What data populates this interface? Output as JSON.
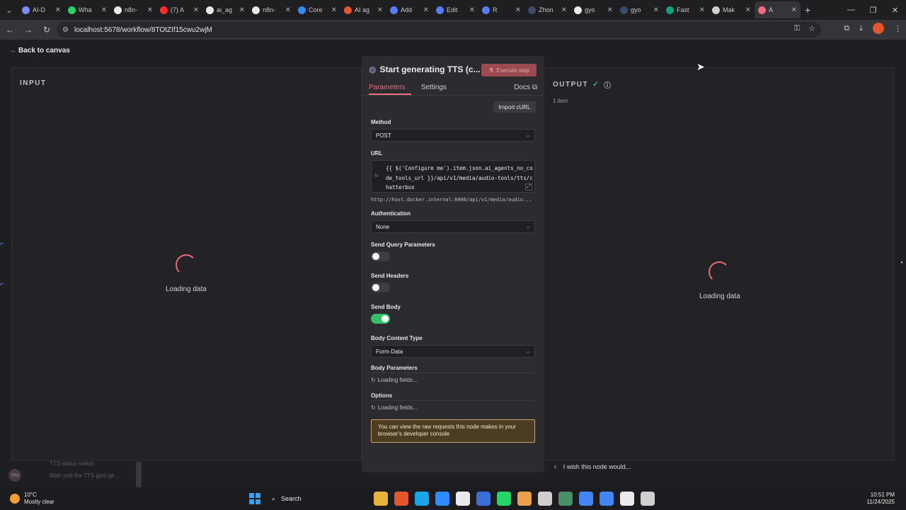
{
  "browser": {
    "tabs": [
      {
        "label": "AI-D",
        "color": "#7b8cff"
      },
      {
        "label": "Wha",
        "color": "#25d366"
      },
      {
        "label": "n8n-",
        "color": "#eaeaea"
      },
      {
        "label": "(7) A",
        "color": "#ff2d2d"
      },
      {
        "label": "ai_ag",
        "color": "#eaeaea"
      },
      {
        "label": "n8n-",
        "color": "#eaeaea"
      },
      {
        "label": "Core",
        "color": "#2d8cff"
      },
      {
        "label": "AI ag",
        "color": "#e4572e"
      },
      {
        "label": "Add",
        "color": "#5a7bff"
      },
      {
        "label": "Edit",
        "color": "#5a7bff"
      },
      {
        "label": "R",
        "color": "#5a7bff"
      },
      {
        "label": "Zhon",
        "color": "#444a66"
      },
      {
        "label": "gyo",
        "color": "#eaeaea"
      },
      {
        "label": "gyo",
        "color": "#3a4a6a"
      },
      {
        "label": "Fast",
        "color": "#10a37f"
      },
      {
        "label": "Mak",
        "color": "#cfcfcf"
      },
      {
        "label": "A",
        "color": "#ef6b7d"
      }
    ],
    "address": "localhost:5678/workflow/8TOtZIf15cwu2wjM"
  },
  "app": {
    "back_label": "Back to canvas",
    "input_title": "INPUT",
    "output_title": "OUTPUT",
    "item_count": "1 item",
    "loading_data": "Loading data",
    "wish": "I wish this node would..."
  },
  "node": {
    "title": "Start generating TTS (c...",
    "execute_label": "Execute step",
    "tabs": {
      "parameters": "Parameters",
      "settings": "Settings",
      "docs": "Docs"
    },
    "import_curl": "Import cURL",
    "method": {
      "label": "Method",
      "value": "POST"
    },
    "url": {
      "label": "URL",
      "expression": "{{ $('Configure me').item.json.ai_agents_no_code_tools_url }}/api/v1/media/audio-tools/tts/chatterbox",
      "resolved": "http://host.docker.internal:8000/api/v1/media/audio..."
    },
    "authentication": {
      "label": "Authentication",
      "value": "None"
    },
    "send_query": {
      "label": "Send Query Parameters",
      "on": false
    },
    "send_headers": {
      "label": "Send Headers",
      "on": false
    },
    "send_body": {
      "label": "Send Body",
      "on": true
    },
    "body_content_type": {
      "label": "Body Content Type",
      "value": "Form-Data"
    },
    "body_parameters": {
      "label": "Body Parameters",
      "loading": "Loading fields..."
    },
    "options": {
      "label": "Options",
      "loading": "Loading fields..."
    },
    "notice": "You can view the raw requests this node makes in your browser's developer console"
  },
  "peek": {
    "line1": "TTS status switch",
    "line2": "Wait until the TTS gets ge...",
    "avatar": "RM"
  },
  "taskbar": {
    "temp": "10°C",
    "weather": "Mostly clear",
    "search": "Search",
    "time": "10:51 PM",
    "date": "11/24/2025",
    "icon_colors": [
      "#e7b33a",
      "#e4572e",
      "#1aa5e8",
      "#2d8cff",
      "#eaeaea",
      "#3b6fd8",
      "#25d366",
      "#e8a04a",
      "#cfcfcf",
      "#4a8f6a",
      "#4285f4",
      "#4285f4",
      "#eaeaea",
      "#cfcfcf"
    ]
  }
}
